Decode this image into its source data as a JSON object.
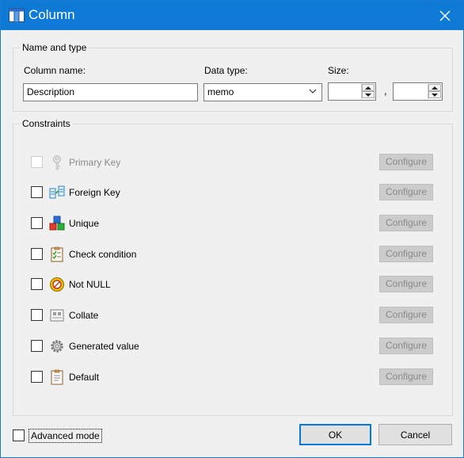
{
  "window": {
    "title": "Column",
    "title_icon": "table-column-icon",
    "close_icon": "close-icon"
  },
  "name_type_group": {
    "label": "Name and type",
    "column_name_label": "Column name:",
    "column_name_value": "Description",
    "data_type_label": "Data type:",
    "data_type_value": "memo",
    "size_label": "Size:",
    "size_value_1": "",
    "size_separator": ",",
    "size_value_2": ""
  },
  "constraints_group": {
    "label": "Constraints",
    "configure_label": "Configure",
    "items": [
      {
        "label": "Primary Key",
        "icon": "key-icon",
        "enabled": false,
        "checked": false
      },
      {
        "label": "Foreign Key",
        "icon": "foreign-key-icon",
        "enabled": true,
        "checked": false
      },
      {
        "label": "Unique",
        "icon": "unique-cubes-icon",
        "enabled": true,
        "checked": false
      },
      {
        "label": "Check condition",
        "icon": "checklist-icon",
        "enabled": true,
        "checked": false
      },
      {
        "label": "Not NULL",
        "icon": "not-null-icon",
        "enabled": true,
        "checked": false
      },
      {
        "label": "Collate",
        "icon": "collate-icon",
        "enabled": true,
        "checked": false
      },
      {
        "label": "Generated value",
        "icon": "gear-icon",
        "enabled": true,
        "checked": false
      },
      {
        "label": "Default",
        "icon": "clipboard-icon",
        "enabled": true,
        "checked": false
      }
    ]
  },
  "footer": {
    "advanced_mode_label": "Advanced mode",
    "ok_label": "OK",
    "cancel_label": "Cancel"
  },
  "colors": {
    "titlebar": "#0f7ad6",
    "dialog_bg": "#f0f0f0",
    "focus_border": "#0078d7"
  }
}
